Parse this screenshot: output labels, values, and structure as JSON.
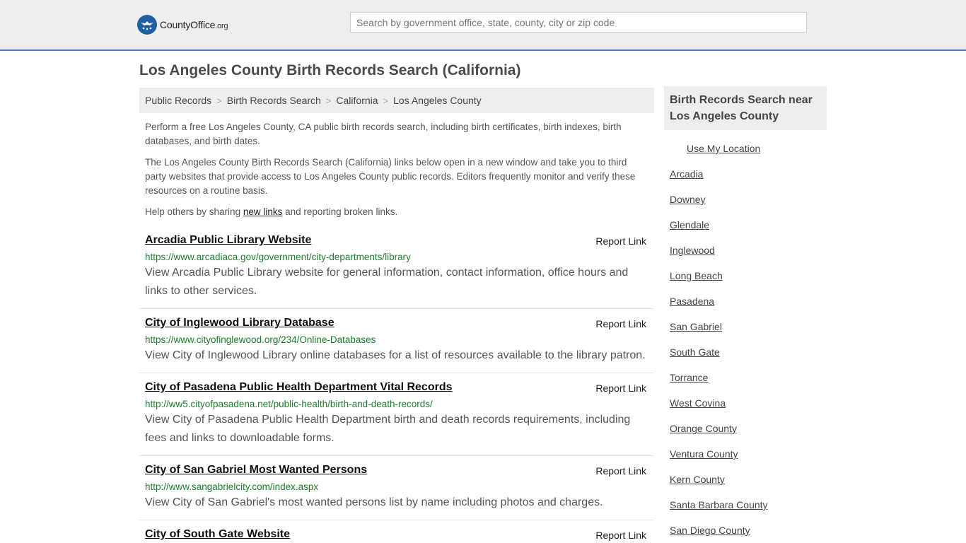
{
  "header": {
    "logo_main": "CountyOffice",
    "logo_suffix": ".org",
    "search_placeholder": "Search by government office, state, county, city or zip code"
  },
  "page_title": "Los Angeles County Birth Records Search (California)",
  "breadcrumb": [
    "Public Records",
    "Birth Records Search",
    "California",
    "Los Angeles County"
  ],
  "intro": {
    "p1": "Perform a free Los Angeles County, CA public birth records search, including birth certificates, birth indexes, birth databases, and birth dates.",
    "p2": "The Los Angeles County Birth Records Search (California) links below open in a new window and take you to third party websites that provide access to Los Angeles County public records. Editors frequently monitor and verify these resources on a routine basis.",
    "p3_before": "Help others by sharing ",
    "p3_link": "new links",
    "p3_after": " and reporting broken links."
  },
  "report_label": "Report Link",
  "results": [
    {
      "title": "Arcadia Public Library Website",
      "url": "https://www.arcadiaca.gov/government/city-departments/library",
      "desc": "View Arcadia Public Library website for general information, contact information, office hours and links to other services."
    },
    {
      "title": "City of Inglewood Library Database",
      "url": "https://www.cityofinglewood.org/234/Online-Databases",
      "desc": "View City of Inglewood Library online databases for a list of resources available to the library patron."
    },
    {
      "title": "City of Pasadena Public Health Department Vital Records",
      "url": "http://ww5.cityofpasadena.net/public-health/birth-and-death-records/",
      "desc": "View City of Pasadena Public Health Department birth and death records requirements, including fees and links to downloadable forms."
    },
    {
      "title": "City of San Gabriel Most Wanted Persons",
      "url": "http://www.sangabrielcity.com/index.aspx",
      "desc": "View City of San Gabriel's most wanted persons list by name including photos and charges."
    },
    {
      "title": "City of South Gate Website",
      "url": "",
      "desc": ""
    }
  ],
  "sidebar": {
    "heading": "Birth Records Search near Los Angeles County",
    "use_location": "Use My Location",
    "links": [
      "Arcadia",
      "Downey",
      "Glendale",
      "Inglewood",
      "Long Beach",
      "Pasadena",
      "San Gabriel",
      "South Gate",
      "Torrance",
      "West Covina",
      "Orange County",
      "Ventura County",
      "Kern County",
      "Santa Barbara County",
      "San Diego County"
    ]
  },
  "colors": {
    "accent": "#3a7fd5",
    "url_green": "#1d7d2d",
    "logo_blue": "#1f5fa6"
  }
}
